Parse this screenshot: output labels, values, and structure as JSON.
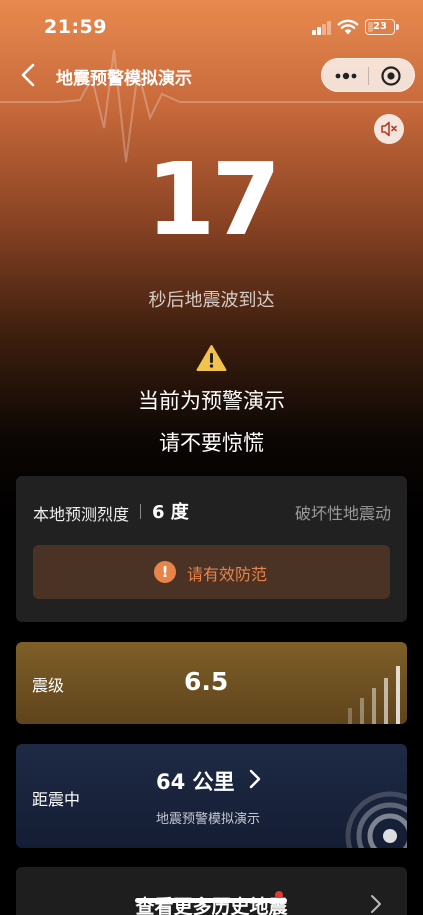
{
  "status": {
    "time": "21:59",
    "battery": "23",
    "battery_level": 0.23
  },
  "nav": {
    "title": "地震预警模拟演示"
  },
  "countdown": {
    "value": "17",
    "subtitle": "秒后地震波到达"
  },
  "notice": {
    "line1": "当前为预警演示",
    "line2": "请不要惊慌"
  },
  "intensity_card": {
    "label": "本地预测烈度",
    "value": "6 度",
    "level": "破坏性地震动",
    "advice": "请有效防范"
  },
  "magnitude_card": {
    "label": "震级",
    "value": "6.5"
  },
  "distance_card": {
    "label": "距震中",
    "value": "64 公里",
    "note": "地震预警模拟演示"
  },
  "history_card": {
    "label": "查看更多历史地震"
  },
  "colors": {
    "accent": "#e8834a",
    "header": "#e88a4e"
  }
}
